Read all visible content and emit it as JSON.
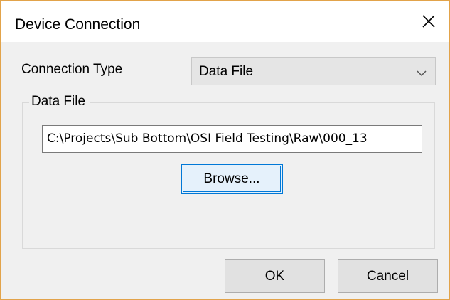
{
  "window": {
    "title": "Device Connection",
    "close_icon": "close-icon"
  },
  "connection": {
    "label": "Connection Type",
    "selected": "Data File"
  },
  "data_file_group": {
    "legend": "Data File",
    "path_value": "C:\\Projects\\Sub Bottom\\OSI Field Testing\\Raw\\000_13",
    "browse_label": "Browse..."
  },
  "footer": {
    "ok_label": "OK",
    "cancel_label": "Cancel"
  },
  "colors": {
    "window_border": "#e2a34a",
    "focus_accent": "#0078d7",
    "dialog_background": "#f0f0f0"
  }
}
